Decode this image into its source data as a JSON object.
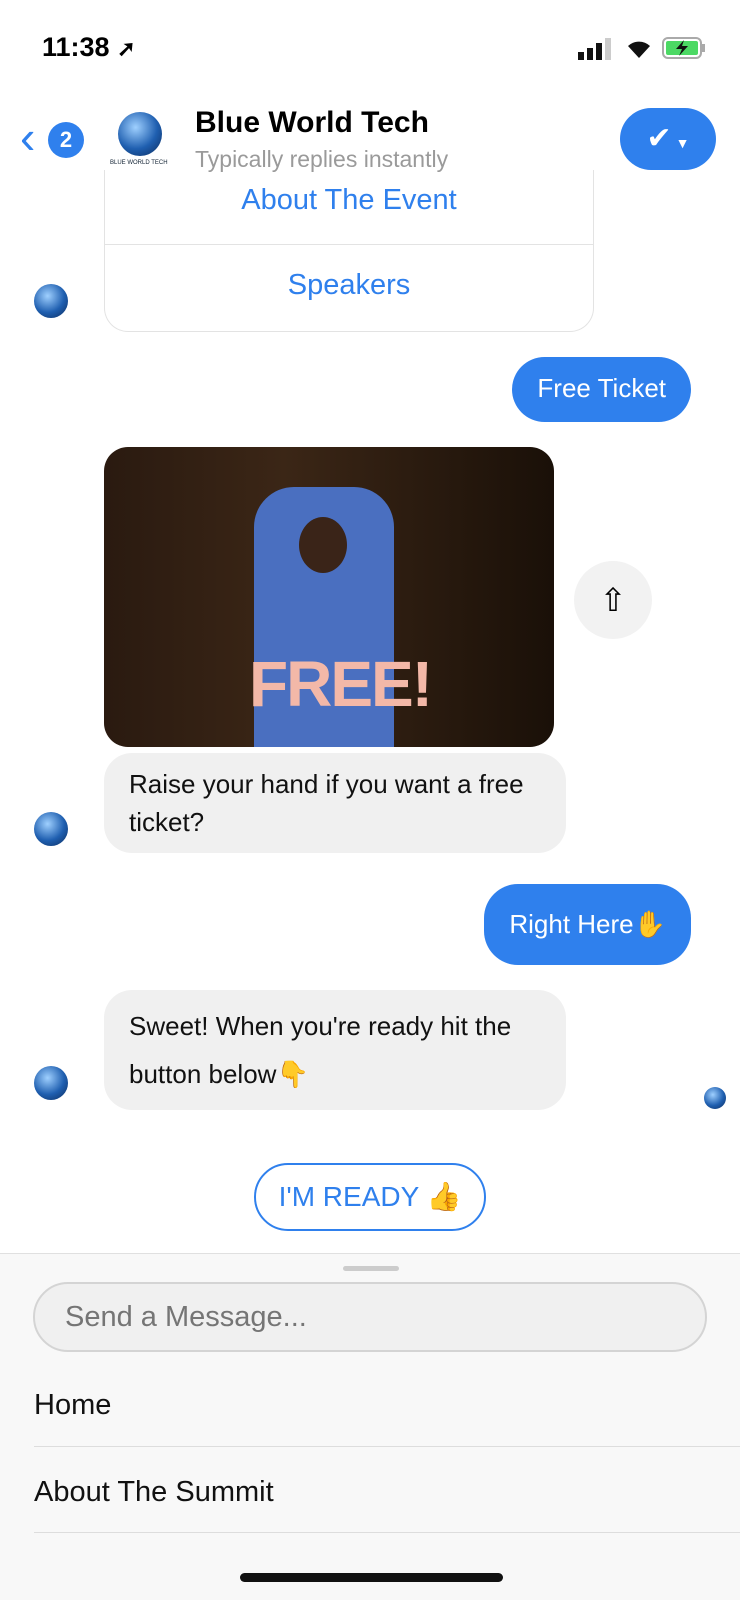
{
  "status_bar": {
    "time": "11:38",
    "location_icon": "location-arrow-icon",
    "signal_icon": "cellular-signal-icon",
    "wifi_icon": "wifi-icon",
    "battery_icon": "battery-charging-icon"
  },
  "header": {
    "back_count": "2",
    "title": "Blue World Tech",
    "subtitle": "Typically replies instantly",
    "logo_text": "BLUE WORLD TECH",
    "action_icon": "checkmark-dropdown-icon"
  },
  "messages": {
    "card_buttons": [
      "About The Event",
      "Speakers"
    ],
    "free_ticket": "Free Ticket",
    "gif_caption": "FREE!",
    "raise_hand": "Raise your hand if you want a free ticket?",
    "right_here": "Right Here✋",
    "sweet": "Sweet! When you're ready hit the button below👇",
    "ready_button": "I'M READY 👍"
  },
  "composer": {
    "placeholder": "Send a Message...",
    "menu": [
      "Home",
      "About The Summit"
    ]
  },
  "colors": {
    "accent": "#2f80ed",
    "incoming_bubble": "#f0f0f0"
  }
}
